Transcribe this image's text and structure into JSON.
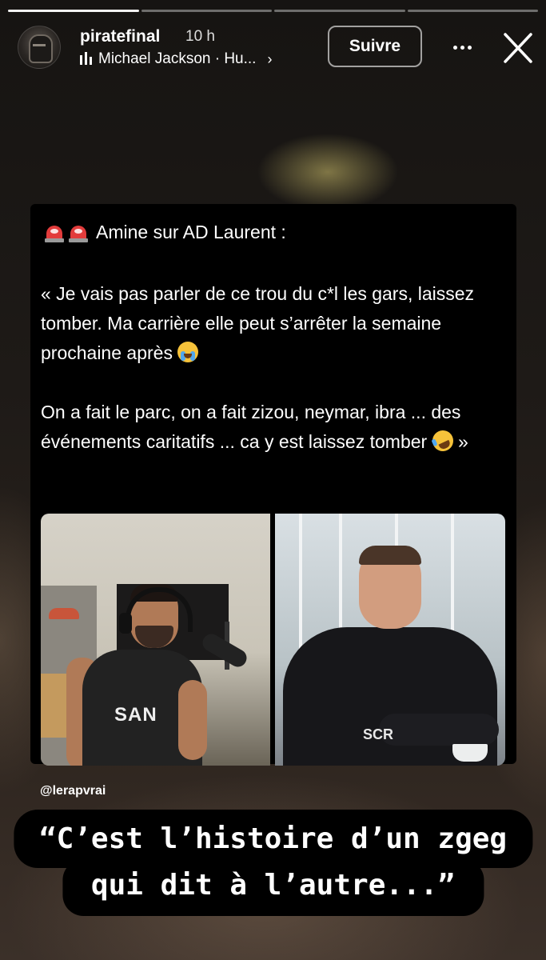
{
  "story": {
    "progress": {
      "segments": 4,
      "current": 1
    },
    "author": {
      "username": "piratefinal",
      "time_ago": "10 h"
    },
    "music": {
      "label": "Michael Jackson · Hu...",
      "icon": "audio-bars-icon"
    },
    "follow_label": "Suivre",
    "icons": {
      "more": "more-options-icon",
      "close": "close-icon"
    }
  },
  "tweet": {
    "header_emoji": [
      "siren-emoji",
      "siren-emoji"
    ],
    "header_text": "Amine sur AD Laurent :",
    "paragraph1": "« Je vais pas parler de ce trou du c*l les gars, laissez tomber. Ma carrière elle peut s’arrêter la semaine prochaine après",
    "paragraph1_emoji": "crying-face-emoji",
    "paragraph2": "On a fait le parc, on a fait zizou, neymar, ibra ... des événements caritatifs ... ca y est laissez tomber",
    "paragraph2_emoji": "rofl-emoji",
    "paragraph2_end": "»",
    "photos": [
      {
        "name": "photo-left",
        "jersey_text": "SAN"
      },
      {
        "name": "photo-right",
        "logo_text": "SCR"
      }
    ]
  },
  "watermark": "@lerapvrai",
  "caption": {
    "line1": "“C’est l’histoire d’un zgeg",
    "line2": "qui dit à l’autre...”"
  },
  "colors": {
    "story_bg": "#1a1512",
    "card_bg": "#000000",
    "caption_bg": "#000000",
    "siren_red": "#e23c3c"
  }
}
